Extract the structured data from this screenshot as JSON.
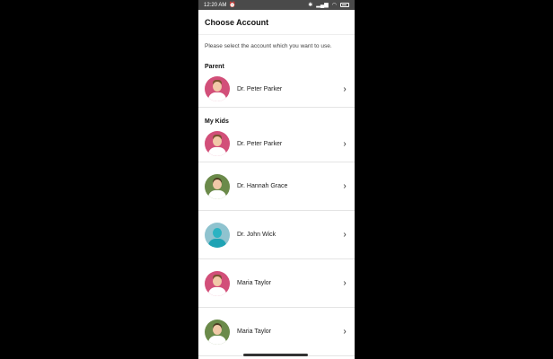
{
  "status": {
    "time": "12:20 AM"
  },
  "header": {
    "title": "Choose Account"
  },
  "subtitle": "Please select the account which you want to use.",
  "sections": {
    "parent": {
      "title": "Parent",
      "items": [
        {
          "name": "Dr. Peter Parker"
        }
      ]
    },
    "kids": {
      "title": "My Kids",
      "items": [
        {
          "name": "Dr. Peter Parker"
        },
        {
          "name": "Dr. Hannah Grace"
        },
        {
          "name": "Dr. John Wick"
        },
        {
          "name": "Maria Taylor"
        },
        {
          "name": "Maria Taylor"
        }
      ]
    }
  },
  "icons": {
    "chevron": "chevron-right-icon"
  }
}
